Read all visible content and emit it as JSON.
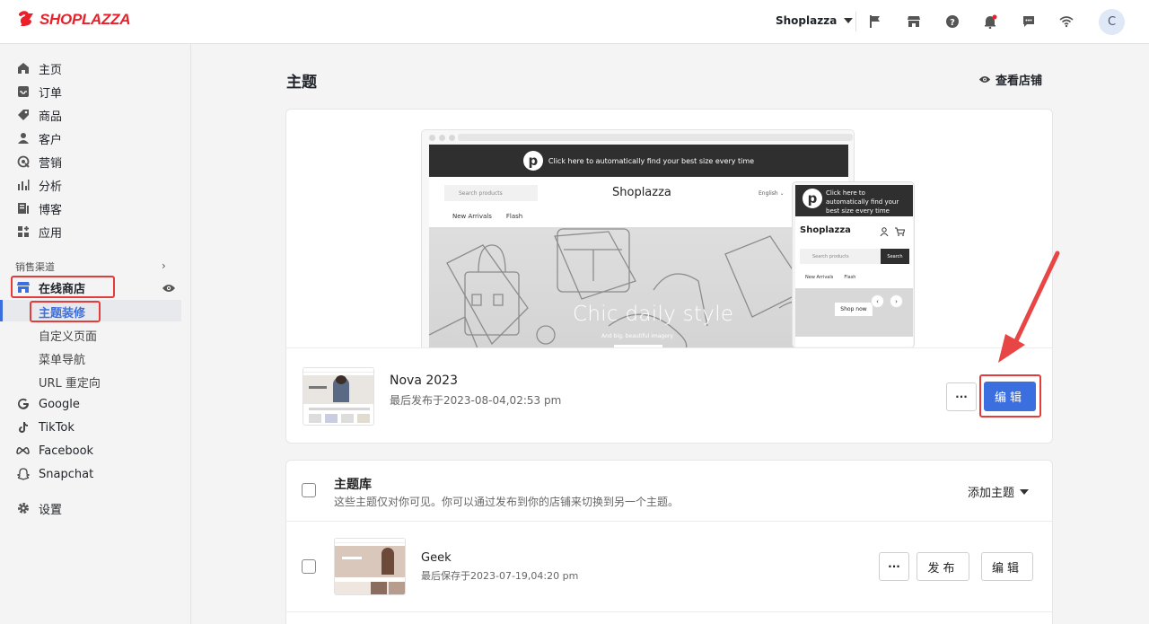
{
  "brand": {
    "name": "SHOPLAZZA",
    "color": "#e8212b"
  },
  "topbar": {
    "store_name": "Shoplazza",
    "avatar_letter": "C",
    "icons": [
      "flag-icon",
      "store-icon",
      "help-icon",
      "bell-icon",
      "chat-icon",
      "wifi-icon"
    ]
  },
  "sidebar": {
    "items": [
      {
        "label": "主页",
        "icon": "home-icon"
      },
      {
        "label": "订单",
        "icon": "inbox-icon"
      },
      {
        "label": "商品",
        "icon": "tag-icon"
      },
      {
        "label": "客户",
        "icon": "person-icon"
      },
      {
        "label": "营销",
        "icon": "target-icon"
      },
      {
        "label": "分析",
        "icon": "bar-chart-icon"
      },
      {
        "label": "博客",
        "icon": "blog-icon"
      },
      {
        "label": "应用",
        "icon": "apps-icon"
      }
    ],
    "channels_label": "销售渠道",
    "online_store": {
      "label": "在线商店",
      "icon": "store-icon"
    },
    "sub_items": [
      "主题装修",
      "自定义页面",
      "菜单导航",
      "URL 重定向"
    ],
    "channels": [
      {
        "label": "Google",
        "icon": "google-icon"
      },
      {
        "label": "TikTok",
        "icon": "tiktok-icon"
      },
      {
        "label": "Facebook",
        "icon": "facebook-icon"
      },
      {
        "label": "Snapchat",
        "icon": "snapchat-icon"
      }
    ],
    "settings_label": "设置"
  },
  "main": {
    "title": "主题",
    "view_store": "查看店铺",
    "preview": {
      "announcement": "Click here to automatically find your best size every time",
      "search_placeholder": "Search products",
      "brand": "Shoplazza",
      "language": "English",
      "nav": [
        "New Arrivals",
        "Flash"
      ],
      "hero_title": "Chic daily style",
      "hero_subtitle": "And big, beautiful imagery",
      "mobile_announcement": "Click here to automatically find your best size every time",
      "mobile_search_button": "Search",
      "mobile_shop_button": "Shop now"
    },
    "current_theme": {
      "name": "Nova 2023",
      "meta": "最后发布于2023-08-04,02:53 pm",
      "more_label": "···",
      "edit_label": "编辑"
    },
    "library": {
      "title": "主题库",
      "description": "这些主题仅对你可见。你可以通过发布到你的店铺来切换到另一个主题。",
      "add_theme": "添加主题",
      "themes": [
        {
          "name": "Geek",
          "meta": "最后保存于2023-07-19,04:20 pm",
          "more_label": "···",
          "publish_label": "发布",
          "edit_label": "编辑"
        }
      ]
    }
  },
  "colors": {
    "accent": "#3b6fe0",
    "annotation": "#e43b3b"
  }
}
